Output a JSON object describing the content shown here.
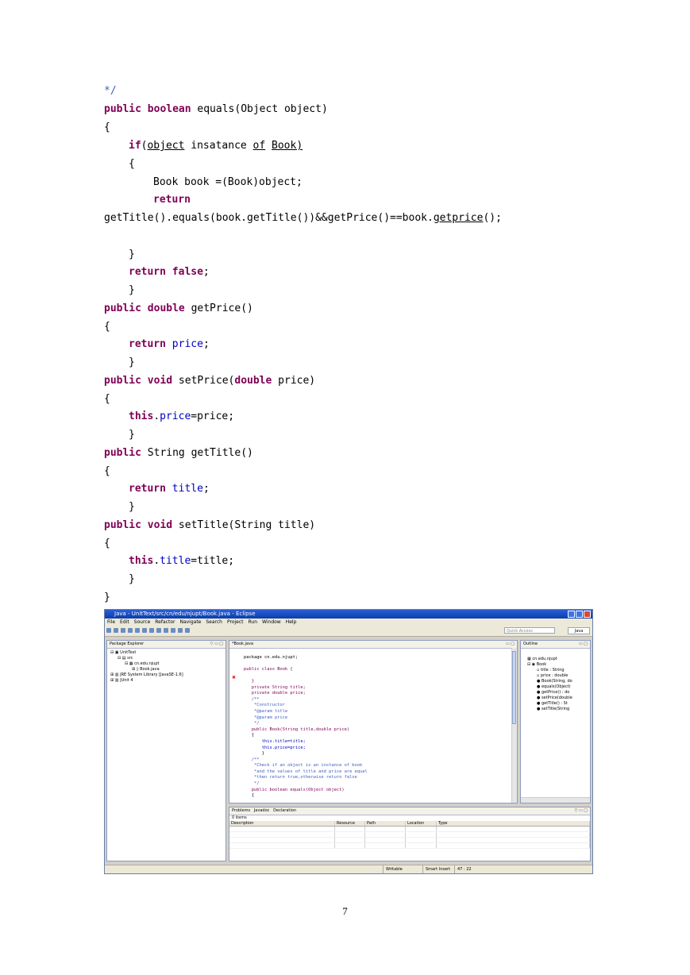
{
  "code_lines": [
    "*/",
    "public boolean equals(Object object)",
    "{",
    "if(object insatance of Book)",
    "{",
    "Book book =(Book)object;",
    "return",
    "getTitle().equals(book.getTitle())&&getPrice()==book.getprice();",
    "}",
    "return false;",
    "}",
    "public double getPrice()",
    "{",
    "return price;",
    "}",
    "public void setPrice(double price)",
    "{",
    "this.price=price;",
    "}",
    "public String getTitle()",
    "{",
    "return title;",
    "}",
    "public void setTitle(String title)",
    "{",
    "this.title=title;",
    "}",
    "}"
  ],
  "screenshot": {
    "window_title": "Java - UnitText/src/cn/edu/njupt/Book.java - Eclipse",
    "menu": [
      "File",
      "Edit",
      "Source",
      "Refactor",
      "Navigate",
      "Search",
      "Project",
      "Run",
      "Window",
      "Help"
    ],
    "quick_access": "Quick Access",
    "perspective": "Java",
    "package_explorer": {
      "tab": "Package Explorer",
      "items": [
        "UnitText",
        "src",
        "cn.edu.njupt",
        "Book.java",
        "JRE System Library [JavaSE-1.6]",
        "JUnit 4"
      ]
    },
    "editor": {
      "tab": "*Book.java",
      "lines": [
        "package cn.edu.njupt;",
        "",
        "public class Book {",
        "",
        "   }",
        "   private String title;",
        "   private double price;",
        "   /**",
        "    *Constructor",
        "    *@param title",
        "    *@param price",
        "    */",
        "   public Book(String title,double price)",
        "   {",
        "       this.title=title;",
        "       this.price=price;",
        "       }",
        "   /**",
        "    *Check if an object is an instance of book",
        "    *and the values of title and price are equal",
        "    *then return true,otherwise return false",
        "    */",
        "   public boolean equals(Object object)",
        "   {"
      ]
    },
    "outline": {
      "tab": "Outline",
      "items": [
        "cn.edu.njupt",
        "Book",
        "title : String",
        "price : double",
        "Book(String, do",
        "equals(Object)",
        "getPrice() : do",
        "setPrice(double",
        "getTitle() : St",
        "setTitle(String"
      ]
    },
    "problems": {
      "tabs": [
        "Problems",
        "Javadoc",
        "Declaration"
      ],
      "count": "0 items",
      "columns": [
        "Description",
        "Resource",
        "Path",
        "Location",
        "Type"
      ]
    },
    "status": {
      "writable": "Writable",
      "insert": "Smart Insert",
      "position": "47 : 22"
    }
  },
  "page_number": "7"
}
